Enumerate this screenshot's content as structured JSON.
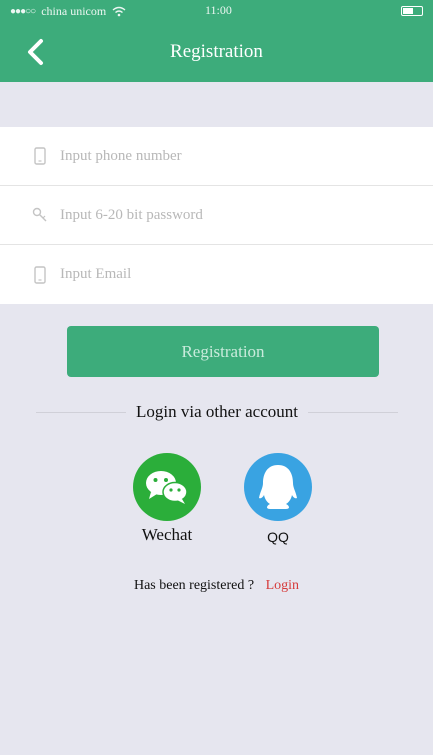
{
  "status_bar": {
    "carrier": "china unicom",
    "time": "11:00"
  },
  "nav": {
    "title": "Registration"
  },
  "form": {
    "phone": {
      "placeholder": "Input phone number",
      "value": ""
    },
    "password": {
      "placeholder": "Input 6-20 bit password",
      "value": ""
    },
    "email": {
      "placeholder": "Input Email",
      "value": ""
    }
  },
  "register_button": {
    "label": "Registration"
  },
  "other_login": {
    "heading": "Login via other account",
    "wechat_label": "Wechat",
    "qq_label": "QQ"
  },
  "footer": {
    "prompt": "Has been registered ?",
    "login_label": "Login"
  },
  "colors": {
    "brand_green": "#3dac7b",
    "background": "#e6e6ef",
    "wechat_green": "#2bae3a",
    "qq_blue": "#39a3e2",
    "link_red": "#d63b3b"
  },
  "icons": {
    "back": "back-chevron-icon",
    "phone": "phone-icon",
    "password": "key-icon",
    "email": "phone-icon",
    "wechat": "wechat-icon",
    "qq": "qq-penguin-icon"
  }
}
